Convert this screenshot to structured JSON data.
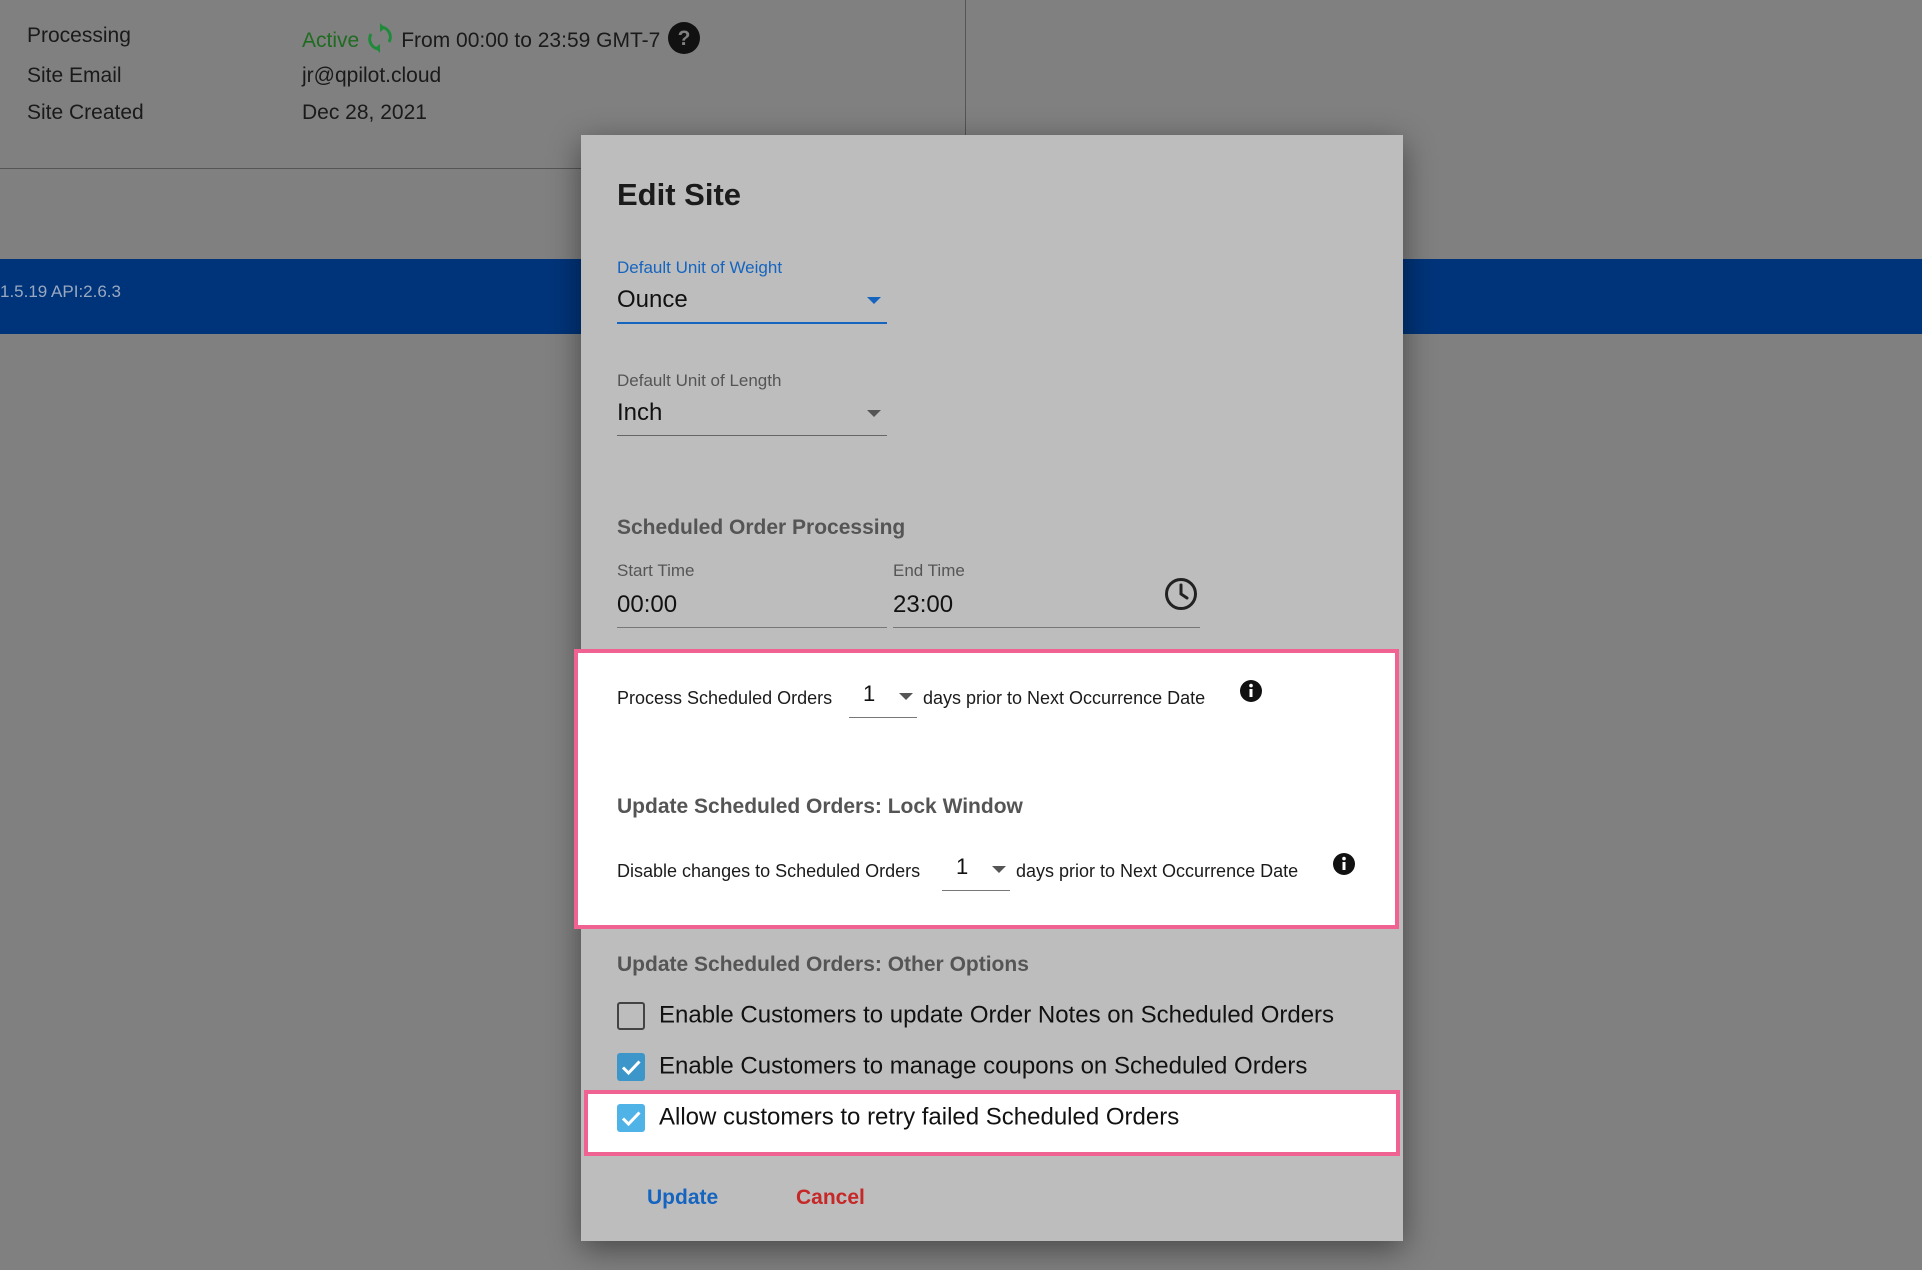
{
  "site_info": {
    "processing_label": "Processing",
    "processing_status": "Active",
    "processing_window": "From 00:00 to 23:59 GMT-7",
    "email_label": "Site Email",
    "email_value": "jr@qpilot.cloud",
    "created_label": "Site Created",
    "created_value": "Dec 28, 2021"
  },
  "footer_bar": {
    "version_text": "1.5.19 API:2.6.3",
    "color": "#00347a"
  },
  "dialog": {
    "title": "Edit Site",
    "weight_unit": {
      "label": "Default Unit of Weight",
      "value": "Ounce"
    },
    "length_unit": {
      "label": "Default Unit of Length",
      "value": "Inch"
    },
    "scheduled_processing": {
      "heading": "Scheduled Order Processing",
      "start_label": "Start Time",
      "start_value": "00:00",
      "end_label": "End Time",
      "end_value": "23:00"
    },
    "process_prior": {
      "prefix": "Process Scheduled Orders",
      "days": "1",
      "suffix": "days prior to Next Occurrence Date"
    },
    "lock_window": {
      "heading": "Update Scheduled Orders: Lock Window",
      "prefix": "Disable changes to Scheduled Orders",
      "days": "1",
      "suffix": "days prior to Next Occurrence Date"
    },
    "other_options": {
      "heading": "Update Scheduled Orders: Other Options",
      "options": [
        {
          "label": "Enable Customers to update Order Notes on Scheduled Orders",
          "checked": false
        },
        {
          "label": "Enable Customers to manage coupons on Scheduled Orders",
          "checked": true
        },
        {
          "label": "Allow customers to retry failed Scheduled Orders",
          "checked": true
        }
      ]
    },
    "update_label": "Update",
    "cancel_label": "Cancel"
  },
  "colors": {
    "accent": "#1565c0",
    "danger": "#c62828",
    "highlight_border": "#f06292",
    "active_status": "#1f6b20",
    "checkbox": "#3d96c9"
  }
}
